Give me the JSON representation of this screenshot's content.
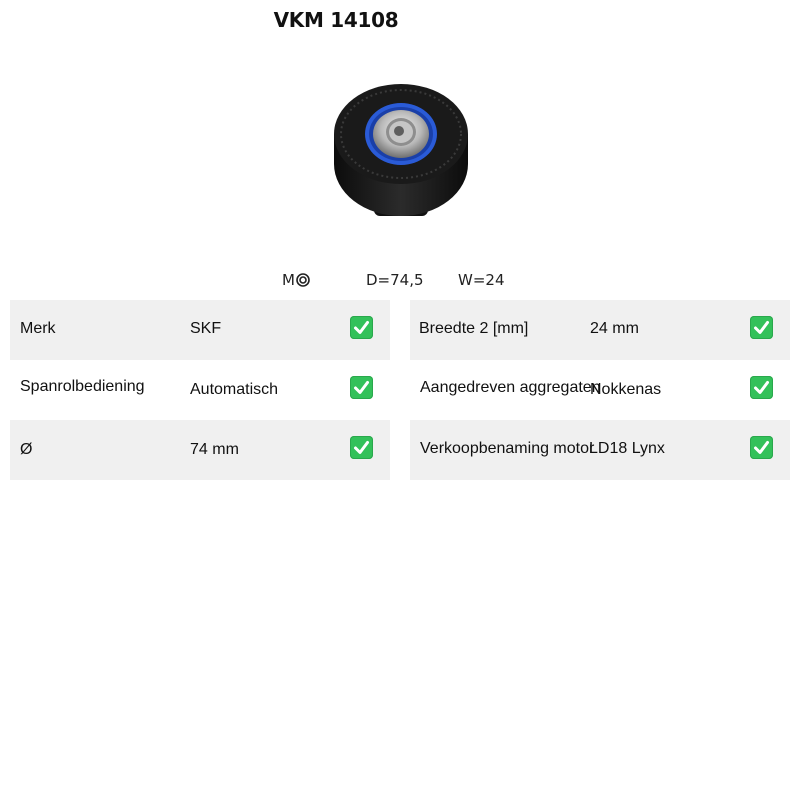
{
  "product": {
    "code": "VKM 14108"
  },
  "specs_line": {
    "m_label": "M",
    "d": "D=74,5",
    "w": "W=24"
  },
  "left_table": [
    {
      "label": "Merk",
      "value": "SKF"
    },
    {
      "label": "Spanrolbediening",
      "value": "Automatisch"
    },
    {
      "label": "Ø",
      "value": "74 mm"
    }
  ],
  "right_table": [
    {
      "label": "Breedte 2 [mm]",
      "value": "24 mm"
    },
    {
      "label": "Aangedreven aggregaten",
      "value": "Nokkenas"
    },
    {
      "label": "Verkoopbenaming motor",
      "value": "LD18 Lynx"
    }
  ],
  "colors": {
    "row_shade": "#f0f0f0",
    "check_green": "#33c15a"
  },
  "icons": {
    "check": "check-mark-icon",
    "thread": "thread-circle-icon"
  }
}
